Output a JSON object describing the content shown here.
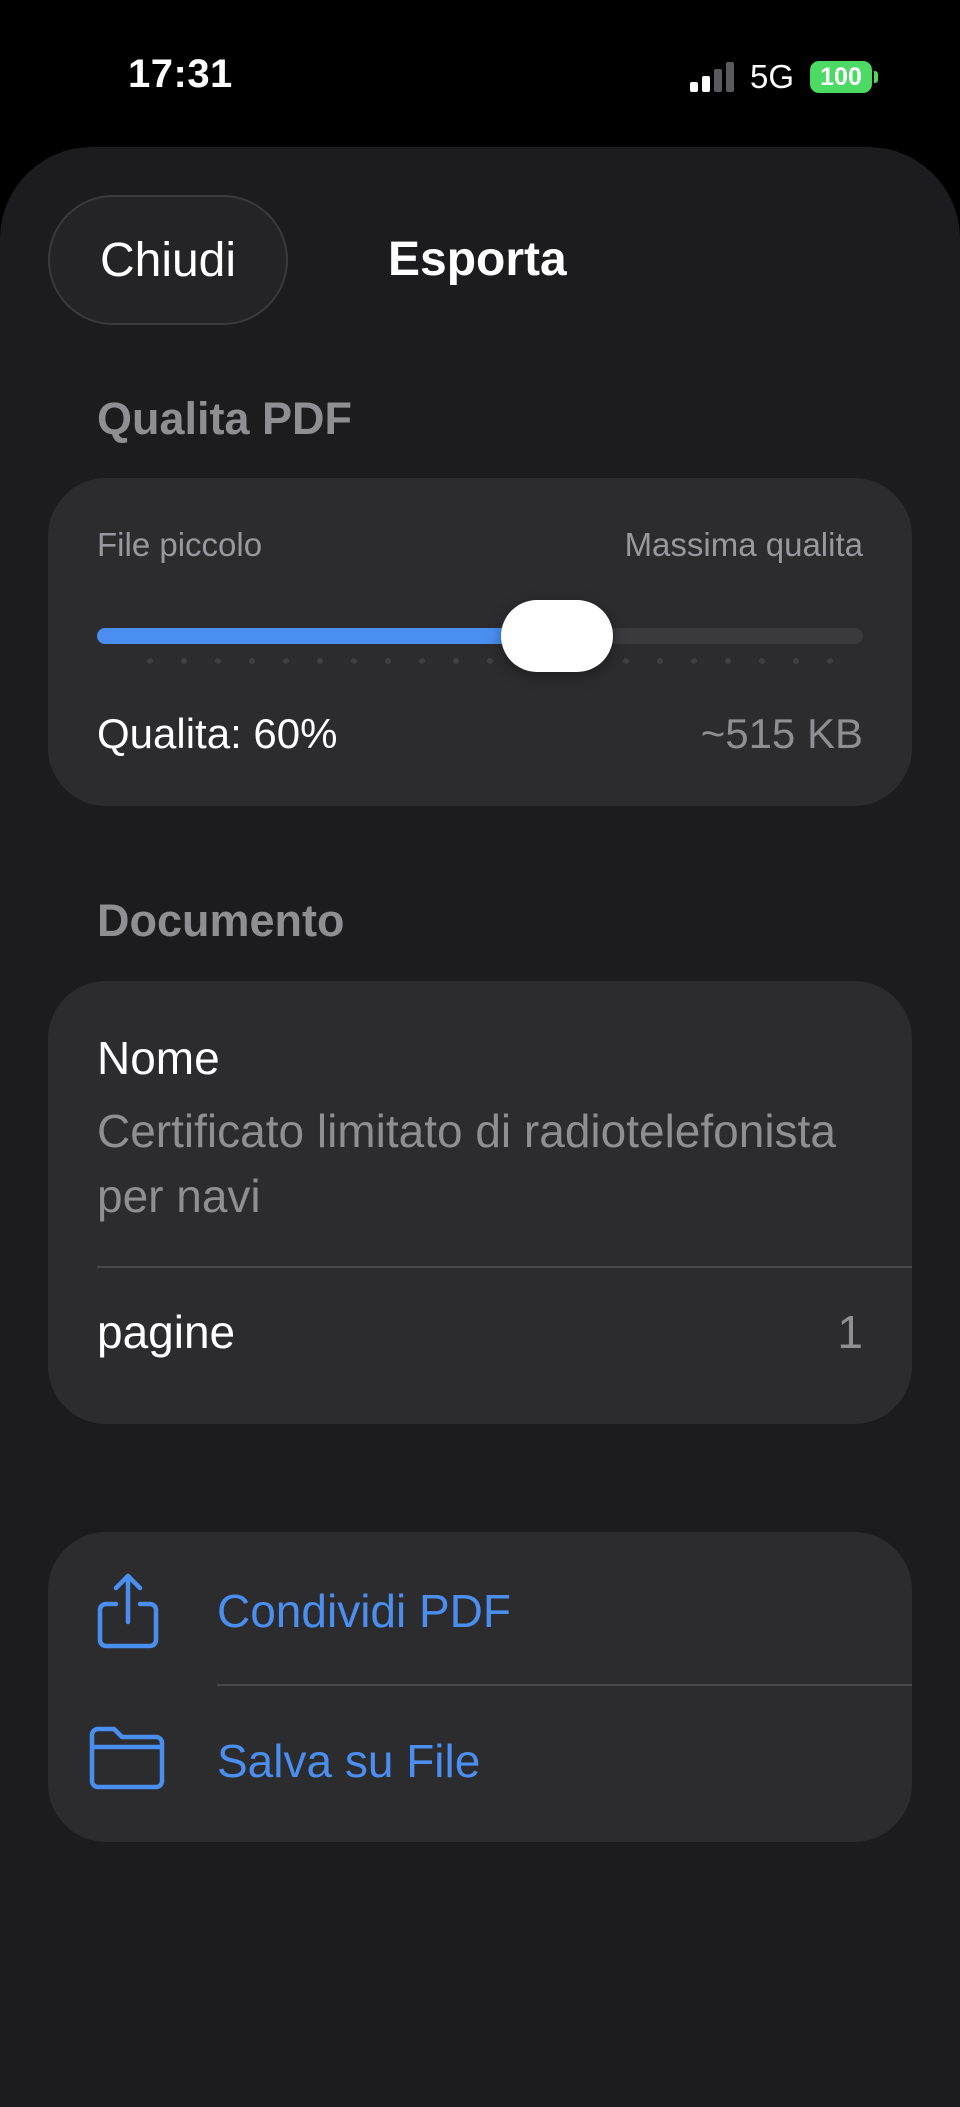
{
  "status_bar": {
    "time": "17:31",
    "network": "5G",
    "battery": "100",
    "battery_color": "#4cd964"
  },
  "nav": {
    "close_label": "Chiudi",
    "title": "Esporta"
  },
  "quality": {
    "section_title": "Qualita PDF",
    "min_label": "File piccolo",
    "max_label": "Massima qualita",
    "value_text": "Qualita: 60%",
    "size_text": "~515 KB",
    "level": 0.6,
    "accent": "#4a8ef0"
  },
  "document": {
    "section_title": "Documento",
    "name_label": "Nome",
    "name_value": "Certificato limitato di radiotelefonista per navi",
    "pages_label": "pagine",
    "pages_value": "1"
  },
  "actions": {
    "color": "#4a8ef0",
    "items": [
      {
        "label": "Condividi PDF",
        "icon": "share-icon"
      },
      {
        "label": "Salva su File",
        "icon": "folder-icon"
      }
    ]
  }
}
